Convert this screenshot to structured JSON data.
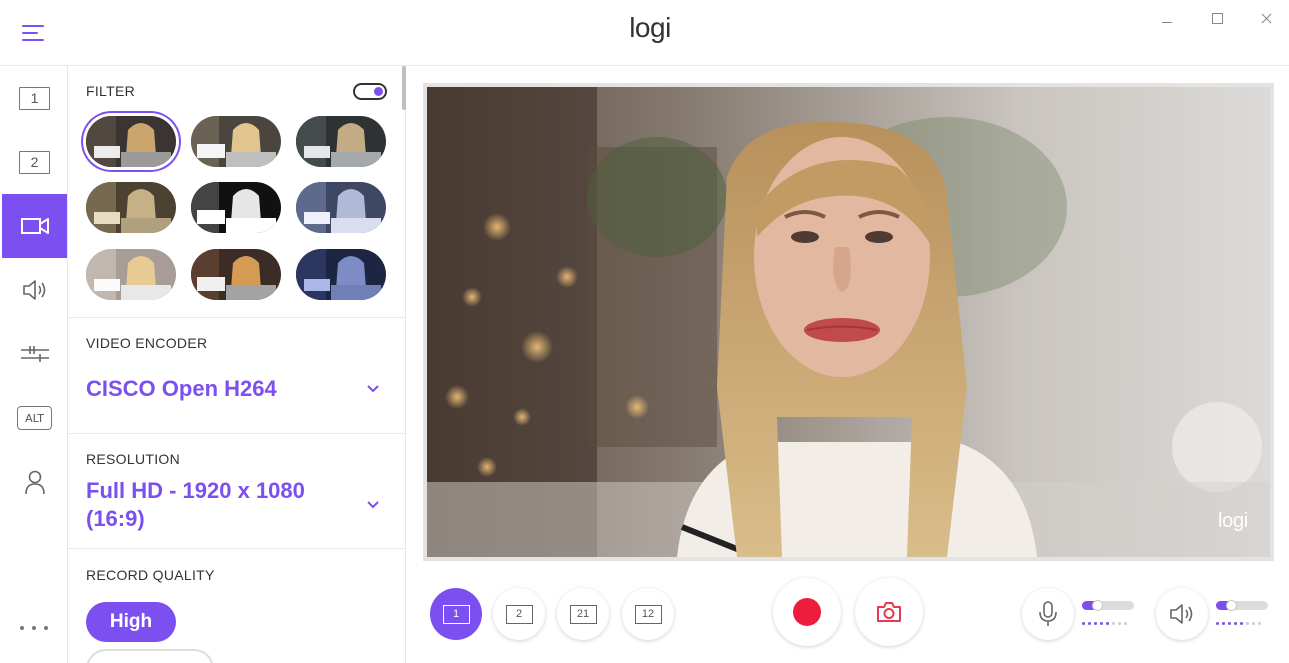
{
  "app": {
    "logo": "logi",
    "preview_logo": "logi"
  },
  "window": {
    "minimize": "minimize",
    "maximize": "maximize",
    "close": "close"
  },
  "nav": {
    "items": [
      {
        "name": "scene-1",
        "label": "1",
        "icon": "scene-1-icon"
      },
      {
        "name": "scene-2",
        "label": "2",
        "icon": "scene-2-icon"
      },
      {
        "name": "camera",
        "label": "",
        "icon": "video-camera-icon",
        "active": true
      },
      {
        "name": "audio",
        "label": "",
        "icon": "speaker-icon"
      },
      {
        "name": "adjustments",
        "label": "",
        "icon": "sliders-icon"
      },
      {
        "name": "alt",
        "label": "ALT",
        "icon": "alt-icon"
      },
      {
        "name": "account",
        "label": "",
        "icon": "user-icon"
      }
    ],
    "more": "more-icon"
  },
  "filter": {
    "title": "FILTER",
    "enabled": true,
    "selected_index": 0,
    "thumbnails": [
      "normal",
      "warm",
      "cool",
      "sepia",
      "high-contrast-mono",
      "blue-tint",
      "bright",
      "vivid",
      "night-blue"
    ]
  },
  "encoder": {
    "title": "VIDEO ENCODER",
    "value": "CISCO Open H264"
  },
  "resolution": {
    "title": "RESOLUTION",
    "value": "Full HD - 1920 x 1080 (16:9)"
  },
  "record_quality": {
    "title": "RECORD QUALITY",
    "selected": "High"
  },
  "controls": {
    "layouts": [
      {
        "label": "1",
        "active": true
      },
      {
        "label": "2",
        "active": false
      },
      {
        "label": "21",
        "active": false
      },
      {
        "label": "12",
        "active": false
      }
    ],
    "record": "record-icon",
    "snapshot": "camera-snapshot-icon",
    "mic_level": 0.3,
    "speaker_level": 0.3
  },
  "colors": {
    "accent": "#7b4ff0",
    "record": "#ee1c3d",
    "snapshot": "#e8384f"
  }
}
